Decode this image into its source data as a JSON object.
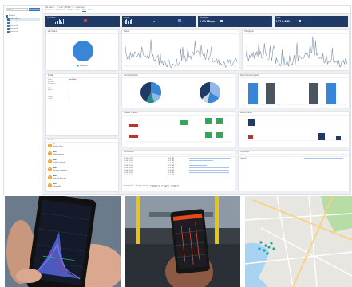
{
  "breadcrumb": "All Sites > ... > Lab > Public > ... Overview",
  "tabs": [
    "Overview",
    "Dashboards",
    "Traffic",
    "Alerts",
    "Map",
    "Events"
  ],
  "tree": {
    "search_placeholder": "search...",
    "filter_button": "Show Devices",
    "items": [
      "All Sites",
      "Lab-Public 1",
      "Device 01",
      "Device 02",
      "Device 03",
      "Device 04"
    ]
  },
  "kpis": [
    {
      "title": "Lab Status",
      "value": "",
      "sub": ""
    },
    {
      "title": "Devices",
      "value": "0",
      "sub": ""
    },
    {
      "title": "Throughput",
      "value": "0.00 Mbps",
      "sub": ""
    },
    {
      "title": "Traffic",
      "value": "137.0 MB",
      "sub": ""
    }
  ],
  "panels": {
    "lab_status": "Lab Status",
    "status": "Status",
    "throughput": "Throughput",
    "details": "Details",
    "alerts": "Alerts",
    "distribution": "Client Distribution",
    "client_counts": "Client Counts by Band",
    "sessions": "Session Timeline",
    "uptime": "Device Uptime",
    "top_devices": "Top Devices",
    "top_clients": "Top Clients"
  },
  "details": [
    {
      "k": "Name",
      "v": "Lab-Public 1"
    },
    {
      "k": "Location",
      "v": "..."
    },
    {
      "k": "IP address",
      "v": "..."
    },
    {
      "k": "MAC",
      "v": "..."
    },
    {
      "k": "Model",
      "v": "..."
    },
    {
      "k": "Firmware",
      "v": "..."
    },
    {
      "k": "Uptime",
      "v": "..."
    },
    {
      "k": "Clients",
      "v": "..."
    }
  ],
  "alerts": [
    {
      "icon": "!",
      "title": "Alert",
      "text": "Device offline"
    },
    {
      "icon": "!",
      "title": "Alert",
      "text": "High utilization"
    },
    {
      "icon": "!",
      "title": "Alert",
      "text": "Config changed"
    },
    {
      "icon": "!",
      "title": "Alert",
      "text": "Firmware outdated"
    },
    {
      "icon": "!",
      "title": "Alert",
      "text": "Link flap detected"
    },
    {
      "icon": "!",
      "title": "Alert",
      "text": "Rogue AP"
    }
  ],
  "top_devices_header": [
    "Device",
    "Usage",
    "Traffic"
  ],
  "top_devices": [
    {
      "name": "10.10.10.101",
      "usage": "XX.X MB",
      "fill": 0.95
    },
    {
      "name": "10.10.10.102",
      "usage": "XX.X MB",
      "fill": 0.55
    },
    {
      "name": "10.10.10.103",
      "usage": "XX.X MB",
      "fill": 0.7
    },
    {
      "name": "10.10.10.104",
      "usage": "XX.X MB",
      "fill": 0.4
    },
    {
      "name": "10.10.10.105",
      "usage": "XX.X MB",
      "fill": 0.9
    },
    {
      "name": "10.10.10.106",
      "usage": "XX.X MB",
      "fill": 0.9
    },
    {
      "name": "10.10.10.107",
      "usage": "XX.X MB",
      "fill": 0.9
    },
    {
      "name": "10.10.10.108",
      "usage": "XX.X MB",
      "fill": 0.9
    }
  ],
  "top_clients_header": [
    "Client",
    "Usage",
    "Traffic"
  ],
  "top_clients": [
    {
      "name": "client-01",
      "usage": "",
      "fill": 0.9
    }
  ],
  "footer": {
    "text": "Copyright 2019 ... All rights reserved",
    "buttons": [
      "Export",
      "Print",
      "Help"
    ]
  },
  "colors": {
    "navy": "#1f3a64",
    "blue": "#3a71b6",
    "slate": "#4a5560",
    "green": "#3aa35a",
    "red": "#b23a2e",
    "orange": "#f0a32f"
  }
}
